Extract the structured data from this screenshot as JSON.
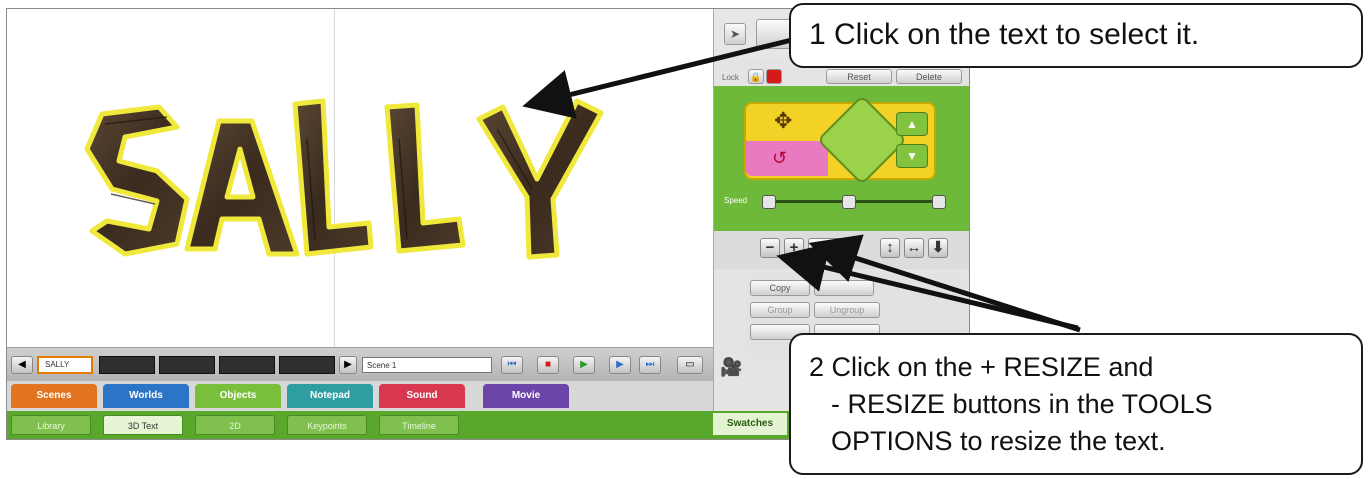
{
  "stage": {
    "text": "SALLY"
  },
  "tools_panel": {
    "top_buttons": [
      "Lock",
      "Reset",
      "Delete"
    ],
    "speed_label": "Speed",
    "resize_buttons": [
      {
        "glyph": "−",
        "name": "minus-resize"
      },
      {
        "glyph": "+",
        "name": "plus-resize"
      },
      {
        "glyph": "↕",
        "name": "stretch-vertical"
      },
      {
        "glyph": "↔",
        "name": "stretch-horizontal"
      },
      {
        "glyph": "⬇",
        "name": "drop"
      }
    ],
    "options": {
      "copy": "Copy",
      "group": "Group",
      "ungroup": "Ungroup"
    }
  },
  "timeline": {
    "first_scene": "SALLY",
    "scene_name": "Scene 1"
  },
  "main_tabs": [
    {
      "label": "Scenes",
      "color": "#e2731f"
    },
    {
      "label": "Worlds",
      "color": "#2c74c6"
    },
    {
      "label": "Objects",
      "color": "#7abf3c"
    },
    {
      "label": "Notepad",
      "color": "#2f9ea2"
    },
    {
      "label": "Sound",
      "color": "#d8384f"
    },
    {
      "label": "Movie",
      "color": "#6b46a8"
    }
  ],
  "sub_tabs": [
    "Library",
    "3D Text",
    "2D",
    "Keypoints",
    "Timeline"
  ],
  "active_sub_tab": "3D Text",
  "swatches_label": "Swatches",
  "callouts": {
    "step1": "1  Click on the text to select it.",
    "step2_line1": "2  Click on the + RESIZE and",
    "step2_line2": "- RESIZE buttons in the TOOLS",
    "step2_line3": "OPTIONS to resize the text."
  }
}
